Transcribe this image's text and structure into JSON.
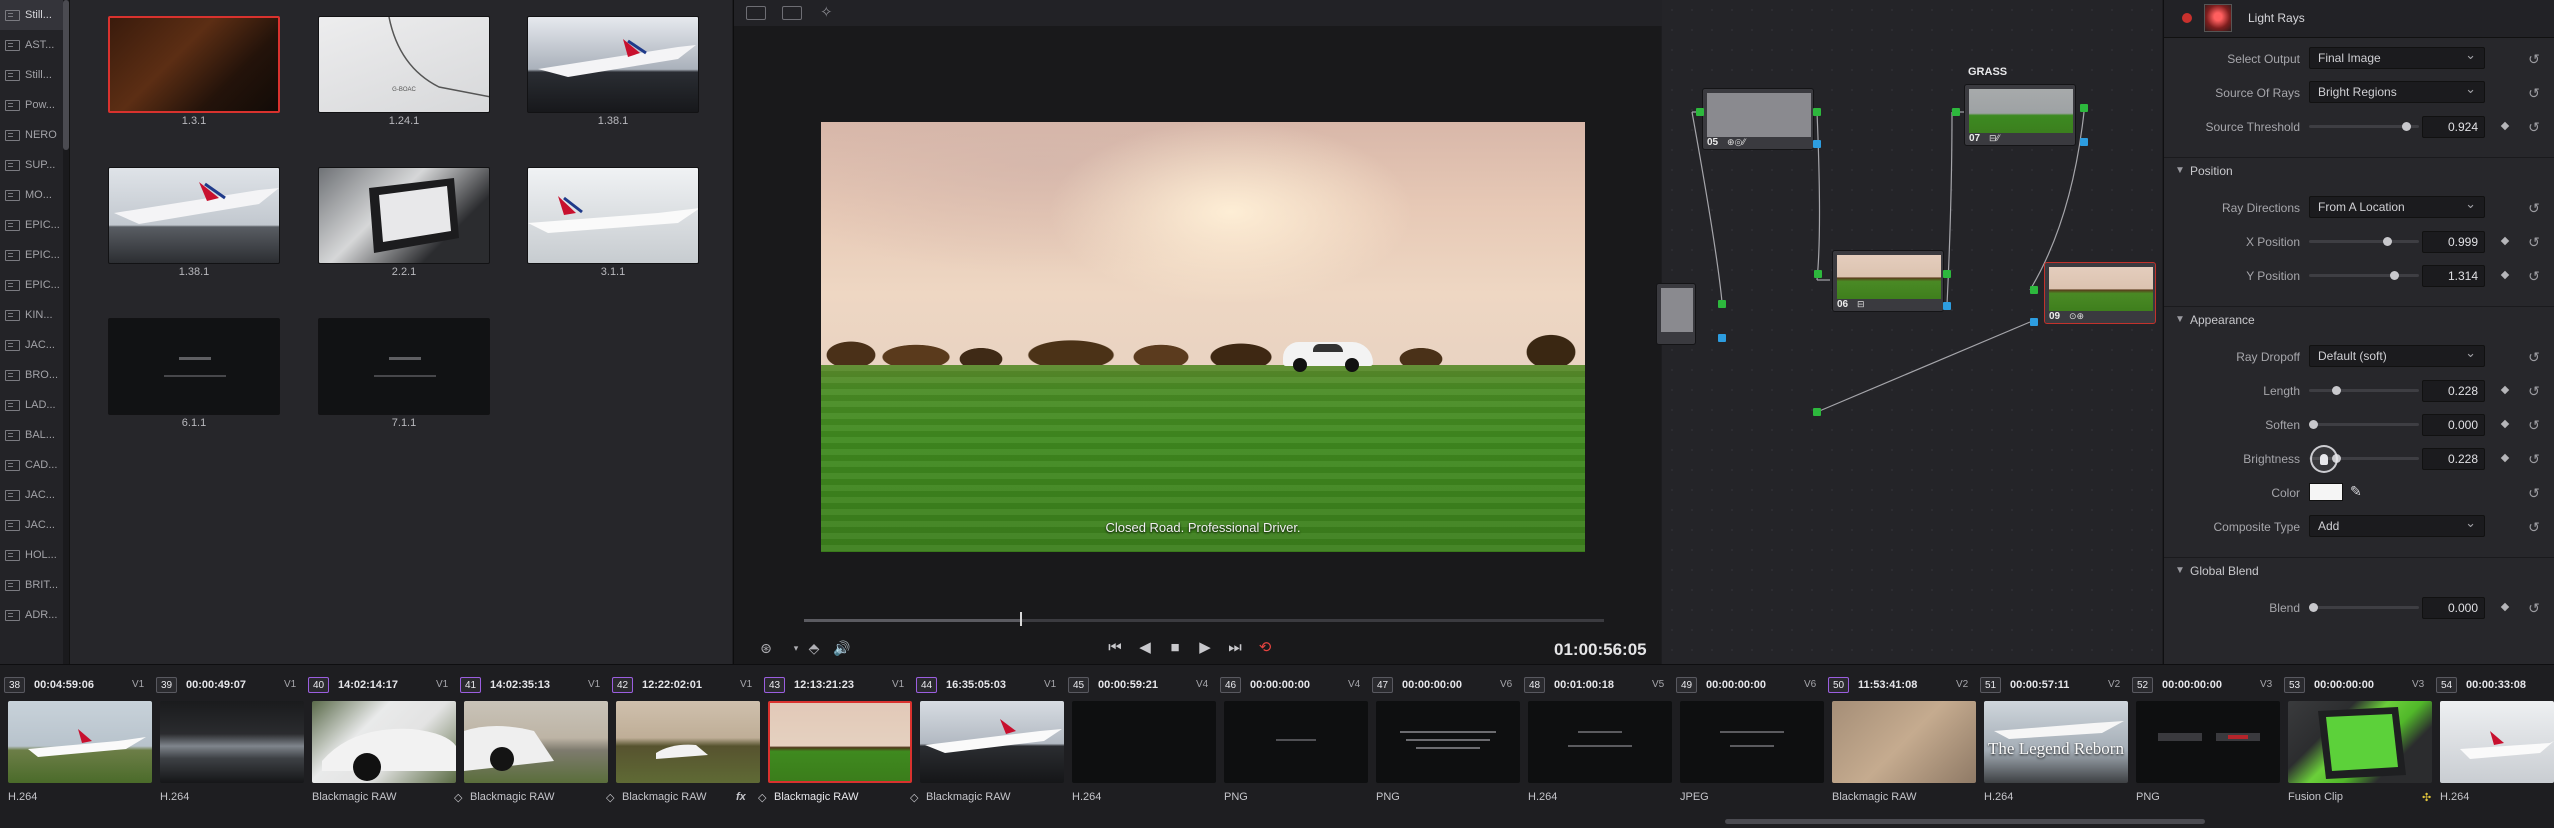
{
  "albums": [
    "Still...",
    "AST...",
    "Still...",
    "Pow...",
    "NERO",
    "SUP...",
    "MO...",
    "EPIC...",
    "EPIC...",
    "EPIC...",
    "KIN...",
    "JAC...",
    "BRO...",
    "LAD...",
    "BAL...",
    "CAD...",
    "JAC...",
    "JAC...",
    "HOL...",
    "BRIT...",
    "ADR..."
  ],
  "gallery": {
    "stills": [
      {
        "label": "1.3.1"
      },
      {
        "label": "1.24.1",
        "text": "G-BOAC"
      },
      {
        "label": "1.38.1"
      },
      {
        "label": "1.38.1"
      },
      {
        "label": "2.2.1"
      },
      {
        "label": "3.1.1"
      },
      {
        "label": "6.1.1"
      },
      {
        "label": "7.1.1"
      }
    ]
  },
  "viewer": {
    "caption": "Closed Road. Professional Driver.",
    "timecode": "01:00:56:05",
    "playhead_fraction": 0.27
  },
  "nodes": {
    "title": "GRASS",
    "items": [
      {
        "label": "05"
      },
      {
        "label": "07"
      },
      {
        "label": "06"
      },
      {
        "label": "09"
      }
    ]
  },
  "inspector": {
    "title": "Light Rays",
    "select_output": {
      "label": "Select Output",
      "value": "Final Image"
    },
    "source_of_rays": {
      "label": "Source Of Rays",
      "value": "Bright Regions"
    },
    "source_threshold": {
      "label": "Source Threshold",
      "value": "0.924",
      "fraction": 0.92
    },
    "position_title": "Position",
    "ray_directions": {
      "label": "Ray Directions",
      "value": "From A Location"
    },
    "x_position": {
      "label": "X Position",
      "value": "0.999",
      "fraction": 0.73
    },
    "y_position": {
      "label": "Y Position",
      "value": "1.314",
      "fraction": 0.8
    },
    "appearance_title": "Appearance",
    "ray_dropoff": {
      "label": "Ray Dropoff",
      "value": "Default (soft)"
    },
    "length": {
      "label": "Length",
      "value": "0.228",
      "fraction": 0.23
    },
    "soften": {
      "label": "Soften",
      "value": "0.000",
      "fraction": 0.0
    },
    "brightness": {
      "label": "Brightness",
      "value": "0.228",
      "fraction": 0.23
    },
    "color": {
      "label": "Color",
      "value": "#f5f5f5"
    },
    "composite_type": {
      "label": "Composite Type",
      "value": "Add"
    },
    "global_blend_title": "Global Blend",
    "blend": {
      "label": "Blend",
      "value": "0.000",
      "fraction": 0.0
    }
  },
  "timeline": {
    "clips": [
      {
        "num": "38",
        "tc": "00:04:59:06",
        "track": "V1",
        "codec": "H.264"
      },
      {
        "num": "39",
        "tc": "00:00:49:07",
        "track": "V1",
        "codec": "H.264"
      },
      {
        "num": "40",
        "tc": "14:02:14:17",
        "track": "V1",
        "codec": "Blackmagic RAW"
      },
      {
        "num": "41",
        "tc": "14:02:35:13",
        "track": "V1",
        "codec": "Blackmagic RAW"
      },
      {
        "num": "42",
        "tc": "12:22:02:01",
        "track": "V1",
        "codec": "Blackmagic RAW"
      },
      {
        "num": "43",
        "tc": "12:13:21:23",
        "track": "V1",
        "codec": "Blackmagic RAW"
      },
      {
        "num": "44",
        "tc": "16:35:05:03",
        "track": "V1",
        "codec": "Blackmagic RAW"
      },
      {
        "num": "45",
        "tc": "00:00:59:21",
        "track": "V4",
        "codec": "H.264"
      },
      {
        "num": "46",
        "tc": "00:00:00:00",
        "track": "V4",
        "codec": "PNG"
      },
      {
        "num": "47",
        "tc": "00:00:00:00",
        "track": "V6",
        "codec": "PNG"
      },
      {
        "num": "48",
        "tc": "00:01:00:18",
        "track": "V5",
        "codec": "H.264"
      },
      {
        "num": "49",
        "tc": "00:00:00:00",
        "track": "V6",
        "codec": "JPEG"
      },
      {
        "num": "50",
        "tc": "11:53:41:08",
        "track": "V2",
        "codec": "Blackmagic RAW"
      },
      {
        "num": "51",
        "tc": "00:00:57:11",
        "track": "V2",
        "codec": "H.264",
        "thumb_text": "The Legend Reborn"
      },
      {
        "num": "52",
        "tc": "00:00:00:00",
        "track": "V3",
        "codec": "PNG"
      },
      {
        "num": "53",
        "tc": "00:00:00:00",
        "track": "V3",
        "codec": "Fusion Clip"
      },
      {
        "num": "54",
        "tc": "00:00:33:08",
        "track": "",
        "codec": "H.264"
      }
    ]
  }
}
